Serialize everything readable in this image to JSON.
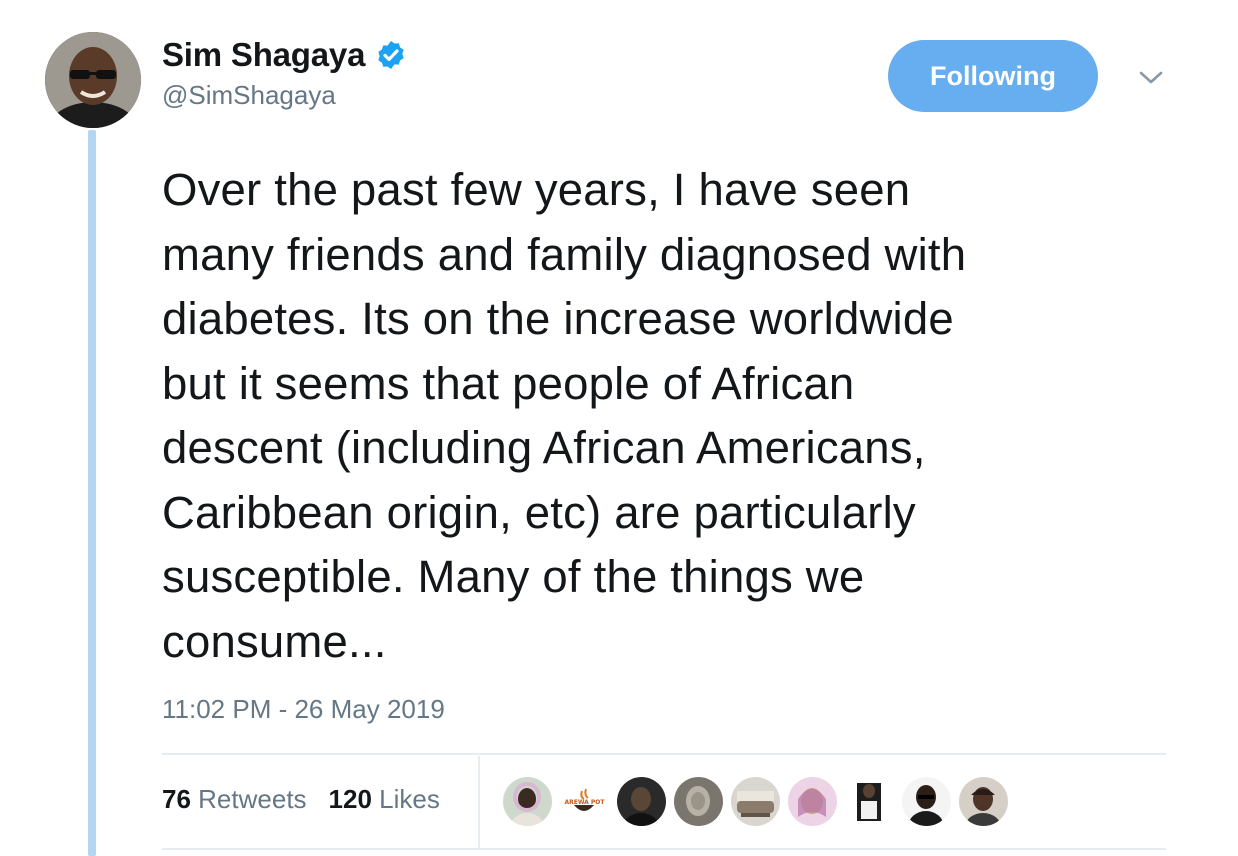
{
  "author": {
    "display_name": "Sim Shagaya",
    "handle": "@SimShagaya",
    "verified_icon": "verified-badge-icon"
  },
  "follow_button": {
    "label": "Following"
  },
  "menu_icon": "chevron-down-icon",
  "tweet": {
    "text": "Over the past few years, I have seen\nmany friends and family diagnosed with\ndiabetes. Its on the increase worldwide\nbut it seems that people of African\ndescent (including African Americans,\nCaribbean origin, etc) are particularly\nsusceptible. Many of the things we\nconsume...",
    "timestamp": "11:02 PM - 26 May 2019"
  },
  "stats": {
    "retweets_count": "76",
    "retweets_label": "Retweets",
    "likes_count": "120",
    "likes_label": "Likes"
  },
  "logo_liker": {
    "text": "AREWA POT"
  },
  "colors": {
    "accent": "#66aef0",
    "thread_line": "#b3d6f2",
    "secondary_text": "#657786",
    "verified": "#1da1f2"
  }
}
